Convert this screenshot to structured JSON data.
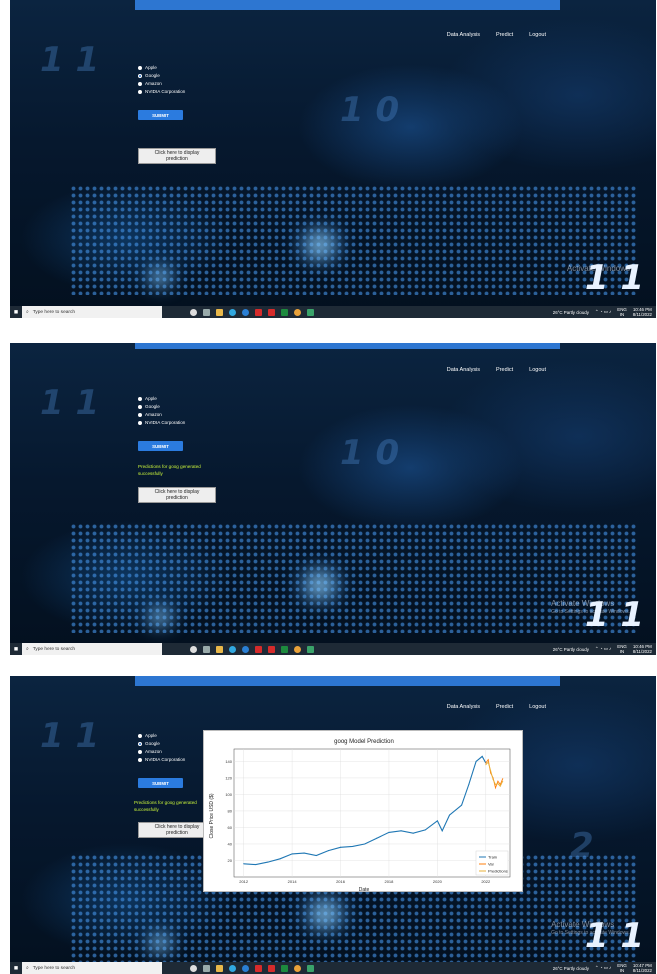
{
  "nav": {
    "data_analysis": "Data Analysis",
    "predict": "Predict",
    "logout": "Logout"
  },
  "radio_options": [
    "Apple",
    "Google",
    "Amazon",
    "NVIDIA Corporation"
  ],
  "selected_option": "Google",
  "submit_label": "SUBMIT",
  "display_button": "Click here to display prediction",
  "success_message": "Predictions for goog generated successfully",
  "watermark": {
    "title": "Activate Windows",
    "subtitle": "Go to Settings to activate Windows."
  },
  "taskbar": {
    "search_placeholder": "Type here to search",
    "weather": "26°C  Partly cloudy",
    "lang": "ENG",
    "region": "IN",
    "date": "8/11/2022",
    "times": [
      "10:46 PM",
      "10:46 PM",
      "10:47 PM"
    ]
  },
  "colors": {
    "accent": "#2d76d1",
    "message": "#c8f23a",
    "train": "#1f77b4",
    "val": "#ff7f0e",
    "pred": "#e8b23a"
  },
  "chart_data": {
    "type": "line",
    "title": "goog Model Prediction",
    "xlabel": "Date",
    "ylabel": "Close Price USD ($)",
    "x_ticks": [
      "2012",
      "2014",
      "2016",
      "2018",
      "2020",
      "2022"
    ],
    "y_ticks": [
      20,
      40,
      60,
      80,
      100,
      120,
      140
    ],
    "ylim": [
      0,
      155
    ],
    "xlim": [
      2011.6,
      2023.0
    ],
    "grid": true,
    "legend_position": "bottom-right",
    "series": [
      {
        "name": "Train",
        "x": [
          2012.0,
          2012.5,
          2013.0,
          2013.5,
          2014.0,
          2014.5,
          2015.0,
          2015.5,
          2016.0,
          2016.5,
          2017.0,
          2017.5,
          2018.0,
          2018.5,
          2019.0,
          2019.5,
          2020.0,
          2020.2,
          2020.5,
          2021.0,
          2021.3,
          2021.6,
          2021.85,
          2022.0
        ],
        "y": [
          16,
          15,
          18,
          22,
          28,
          29,
          26,
          32,
          36,
          37,
          40,
          47,
          54,
          56,
          53,
          57,
          68,
          56,
          75,
          87,
          112,
          140,
          146,
          138
        ]
      },
      {
        "name": "Val",
        "x": [
          2022.0,
          2022.1,
          2022.2,
          2022.3,
          2022.4,
          2022.5,
          2022.6,
          2022.7
        ],
        "y": [
          138,
          142,
          126,
          120,
          108,
          116,
          112,
          119
        ]
      },
      {
        "name": "Predictions",
        "x": [
          2022.0,
          2022.1,
          2022.2,
          2022.3,
          2022.4,
          2022.5,
          2022.6,
          2022.7
        ],
        "y": [
          136,
          139,
          129,
          118,
          112,
          113,
          110,
          116
        ]
      }
    ]
  }
}
